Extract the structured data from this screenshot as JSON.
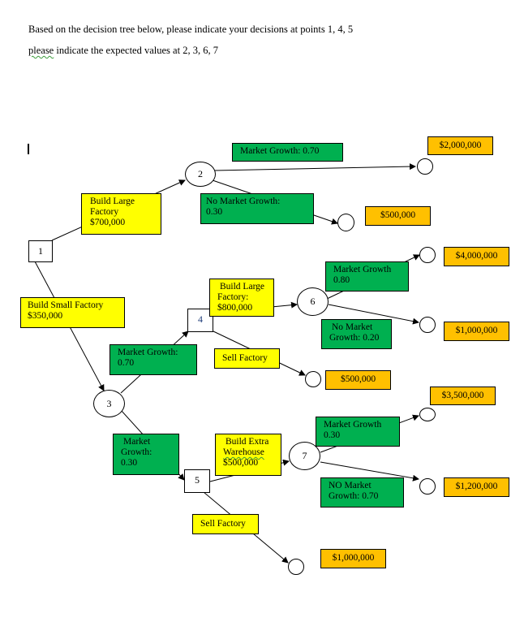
{
  "instructions": {
    "line1": "Based on the decision tree below, please indicate your decisions  at points 1, 4, 5",
    "line2_word": "please",
    "line2_rest": " indicate the expected values at 2, 3, 6, 7"
  },
  "nodes": {
    "decision_1": "1",
    "chance_2": "2",
    "chance_3": "3",
    "decision_4": "4",
    "decision_5": "5",
    "chance_6": "6",
    "chance_7": "7"
  },
  "decisions": {
    "build_large_factory": {
      "line1": "Build Large",
      "line2": "Factory",
      "line3": "$700,000"
    },
    "build_small_factory": {
      "line1": "Build Small Factory",
      "line2": "$350,000"
    },
    "build_large_factory_4": {
      "line1": "Build Large",
      "line2": "Factory:",
      "line3": "$800,000"
    },
    "sell_factory_4": "Sell Factory",
    "build_extra_warehouse": {
      "line1": "Build Extra",
      "line2": "Warehouse",
      "line3": "$500,000"
    },
    "sell_factory_5": "Sell Factory"
  },
  "probabilities": {
    "node2_growth": "Market Growth: 0.70",
    "node2_no_growth": {
      "line1": "No Market Growth:",
      "line2": "0.30"
    },
    "node3_growth": {
      "line1": "Market Growth:",
      "line2": "0.70"
    },
    "node3_no_growth": {
      "line1": "Market",
      "line2": "Growth:",
      "line3": "0.30"
    },
    "node6_growth": {
      "line1": "Market Growth",
      "line2": "0.80"
    },
    "node6_no_growth": {
      "line1": "No Market",
      "line2": "Growth: 0.20"
    },
    "node7_growth": {
      "line1": "Market Growth",
      "line2": "0.30"
    },
    "node7_no_growth": {
      "line1": "NO Market",
      "line2": "Growth: 0.70"
    }
  },
  "payoffs": {
    "p2_growth": "$2,000,000",
    "p2_no_growth": "$500,000",
    "p6_growth": "$4,000,000",
    "p6_no_growth": "$1,000,000",
    "p4_sell": "$500,000",
    "p7_growth": "$3,500,000",
    "p7_no_growth": "$1,200,000",
    "p5_sell": "$1,000,000"
  },
  "colors": {
    "decision_fill": "#ffff00",
    "probability_fill": "#00b050",
    "payoff_fill": "#ffc000"
  }
}
